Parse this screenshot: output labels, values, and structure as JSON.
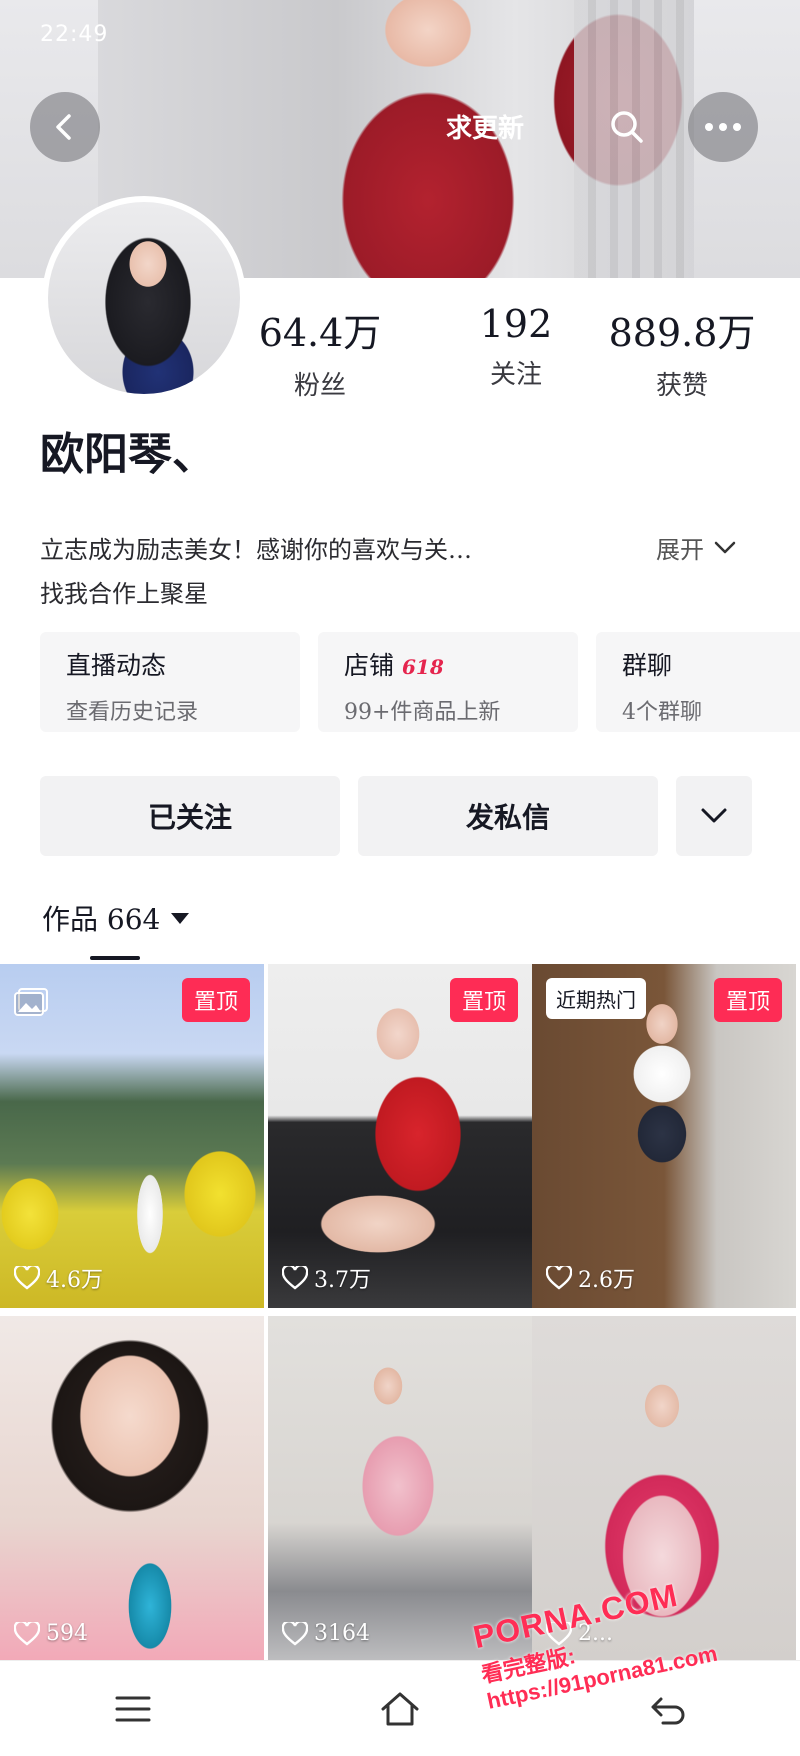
{
  "status_bar": {
    "time": "22:49"
  },
  "header": {
    "request_update": "求更新"
  },
  "profile": {
    "username": "欧阳琴、",
    "stats": [
      {
        "value": "64.4万",
        "label": "粉丝"
      },
      {
        "value": "192",
        "label": "关注"
      },
      {
        "value": "889.8万",
        "label": "获赞"
      }
    ],
    "bio": "立志成为励志美女！感谢你的喜欢与关…",
    "bio_expand": "展开",
    "bio_line2": "找我合作上聚星"
  },
  "cards": {
    "live": {
      "title": "直播动态",
      "sub": "查看历史记录"
    },
    "shop": {
      "title": "店铺",
      "badge": "618",
      "sub": "99+件商品上新"
    },
    "group": {
      "title": "群聊",
      "sub": "4个群聊"
    }
  },
  "actions": {
    "followed": "已关注",
    "message": "发私信"
  },
  "tabs": {
    "works": "作品 664"
  },
  "grid": {
    "pin_label": "置顶",
    "recent_hot": "近期热门",
    "likes": [
      "4.6万",
      "3.7万",
      "2.6万",
      "594",
      "3164",
      "2..."
    ]
  },
  "watermark": {
    "brand": "PORNA.COM",
    "url": "看完整版: https://91porna81.com"
  },
  "colors": {
    "accent": "#fe2c55",
    "text": "#161823"
  }
}
